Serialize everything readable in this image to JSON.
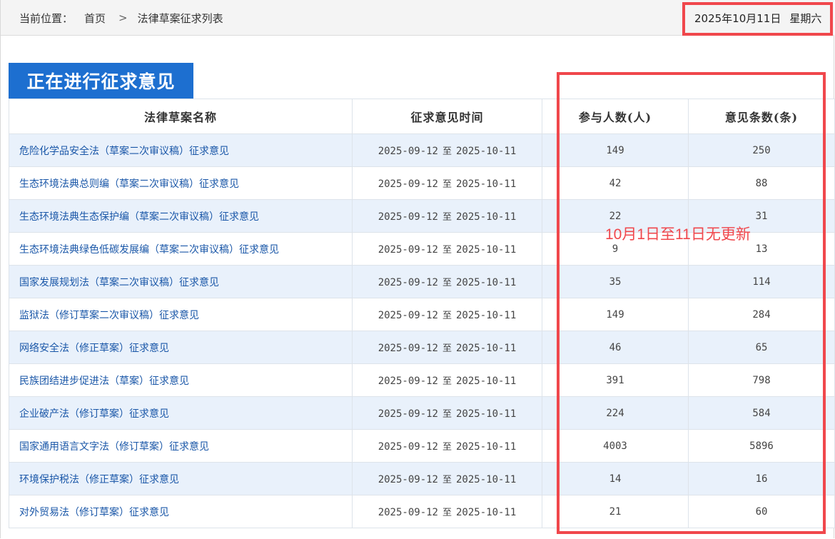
{
  "breadcrumb": {
    "label": "当前位置：",
    "home": "首页",
    "separator": ">",
    "current": "法律草案征求列表"
  },
  "date": {
    "date_text": "2025年10月11日",
    "weekday": "星期六"
  },
  "section_title": "正在进行征求意见",
  "table": {
    "headers": {
      "name": "法律草案名称",
      "period": "征求意见时间",
      "people": "参与人数(人)",
      "opinions": "意见条数(条)"
    },
    "rows": [
      {
        "name": "危险化学品安全法（草案二次审议稿）征求意见",
        "start": "2025-09-12",
        "to": "至",
        "end": "2025-10-11",
        "people": "149",
        "opinions": "250"
      },
      {
        "name": "生态环境法典总则编（草案二次审议稿）征求意见",
        "start": "2025-09-12",
        "to": "至",
        "end": "2025-10-11",
        "people": "42",
        "opinions": "88"
      },
      {
        "name": "生态环境法典生态保护编（草案二次审议稿）征求意见",
        "start": "2025-09-12",
        "to": "至",
        "end": "2025-10-11",
        "people": "22",
        "opinions": "31"
      },
      {
        "name": "生态环境法典绿色低碳发展编（草案二次审议稿）征求意见",
        "start": "2025-09-12",
        "to": "至",
        "end": "2025-10-11",
        "people": "9",
        "opinions": "13"
      },
      {
        "name": "国家发展规划法（草案二次审议稿）征求意见",
        "start": "2025-09-12",
        "to": "至",
        "end": "2025-10-11",
        "people": "35",
        "opinions": "114"
      },
      {
        "name": "监狱法（修订草案二次审议稿）征求意见",
        "start": "2025-09-12",
        "to": "至",
        "end": "2025-10-11",
        "people": "149",
        "opinions": "284"
      },
      {
        "name": "网络安全法（修正草案）征求意见",
        "start": "2025-09-12",
        "to": "至",
        "end": "2025-10-11",
        "people": "46",
        "opinions": "65"
      },
      {
        "name": "民族团结进步促进法（草案）征求意见",
        "start": "2025-09-12",
        "to": "至",
        "end": "2025-10-11",
        "people": "391",
        "opinions": "798"
      },
      {
        "name": "企业破产法（修订草案）征求意见",
        "start": "2025-09-12",
        "to": "至",
        "end": "2025-10-11",
        "people": "224",
        "opinions": "584"
      },
      {
        "name": "国家通用语言文字法（修订草案）征求意见",
        "start": "2025-09-12",
        "to": "至",
        "end": "2025-10-11",
        "people": "4003",
        "opinions": "5896"
      },
      {
        "name": "环境保护税法（修正草案）征求意见",
        "start": "2025-09-12",
        "to": "至",
        "end": "2025-10-11",
        "people": "14",
        "opinions": "16"
      },
      {
        "name": "对外贸易法（修订草案）征求意见",
        "start": "2025-09-12",
        "to": "至",
        "end": "2025-10-11",
        "people": "21",
        "opinions": "60"
      }
    ]
  },
  "annotation": {
    "note": "10月1日至11日无更新",
    "color": "#f0474c"
  },
  "colors": {
    "title_bg": "#1d6fd0",
    "link": "#1a57a8",
    "row_alt": "#e9f1fb"
  }
}
